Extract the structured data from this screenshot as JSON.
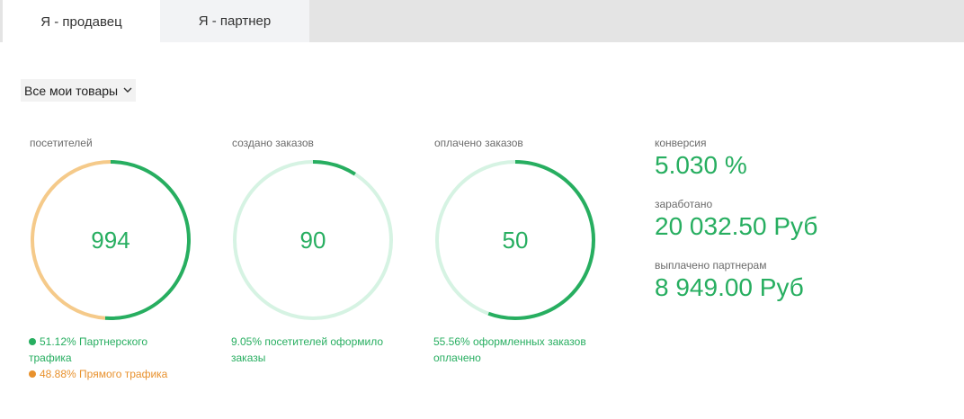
{
  "tabs": [
    {
      "label": "Я - продавец",
      "active": true
    },
    {
      "label": "Я - партнер",
      "active": false
    }
  ],
  "filter": {
    "selected": "Все мои товары"
  },
  "metrics": [
    {
      "label": "посетителей",
      "value": "994",
      "notes": [
        {
          "text": "51.12% Партнерского трафика",
          "color": "#27ae60",
          "dot": true
        },
        {
          "text": "48.88% Прямого трафика",
          "color": "#e8912d",
          "dot": true
        }
      ],
      "ring_segments": [
        {
          "fraction": 0.5112,
          "color": "#27ae60"
        },
        {
          "fraction": 0.4888,
          "color": "#f5ca8a"
        }
      ]
    },
    {
      "label": "создано заказов",
      "value": "90",
      "notes": [
        {
          "text": "9.05% посетителей оформило заказы",
          "color": "#27ae60",
          "dot": false
        }
      ],
      "ring_segments": [
        {
          "fraction": 0.0905,
          "color": "#27ae60"
        }
      ],
      "ring_track": "#d6f3e3"
    },
    {
      "label": "оплачено заказов",
      "value": "50",
      "notes": [
        {
          "text": "55.56% оформленных заказов оплачено",
          "color": "#27ae60",
          "dot": false
        }
      ],
      "ring_segments": [
        {
          "fraction": 0.5556,
          "color": "#27ae60"
        }
      ],
      "ring_track": "#d6f3e3"
    }
  ],
  "stats": [
    {
      "label": "конверсия",
      "value": "5.030 %"
    },
    {
      "label": "заработано",
      "value": "20 032.50 Руб"
    },
    {
      "label": "выплачено партнерам",
      "value": "8 949.00 Руб"
    }
  ]
}
